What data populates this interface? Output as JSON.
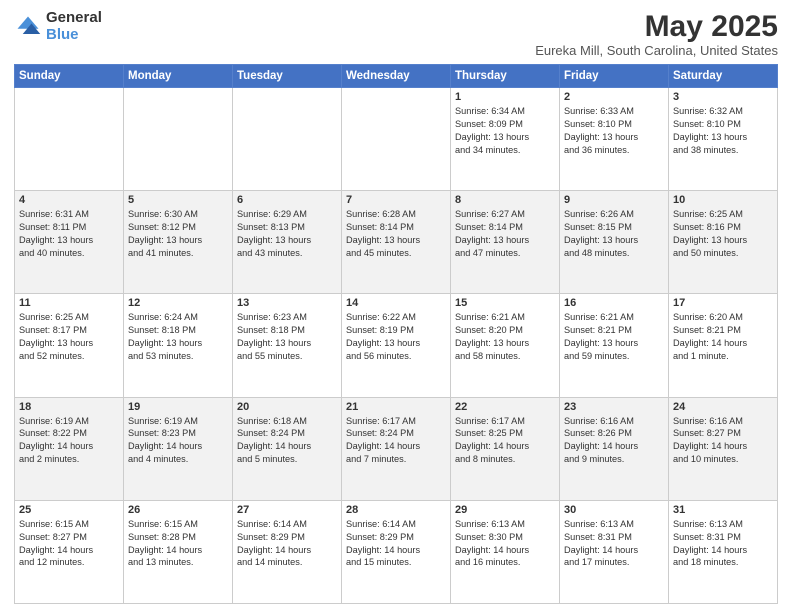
{
  "header": {
    "logo_line1": "General",
    "logo_line2": "Blue",
    "title": "May 2025",
    "subtitle": "Eureka Mill, South Carolina, United States"
  },
  "days_of_week": [
    "Sunday",
    "Monday",
    "Tuesday",
    "Wednesday",
    "Thursday",
    "Friday",
    "Saturday"
  ],
  "weeks": [
    [
      {
        "day": "",
        "info": ""
      },
      {
        "day": "",
        "info": ""
      },
      {
        "day": "",
        "info": ""
      },
      {
        "day": "",
        "info": ""
      },
      {
        "day": "1",
        "info": "Sunrise: 6:34 AM\nSunset: 8:09 PM\nDaylight: 13 hours\nand 34 minutes."
      },
      {
        "day": "2",
        "info": "Sunrise: 6:33 AM\nSunset: 8:10 PM\nDaylight: 13 hours\nand 36 minutes."
      },
      {
        "day": "3",
        "info": "Sunrise: 6:32 AM\nSunset: 8:10 PM\nDaylight: 13 hours\nand 38 minutes."
      }
    ],
    [
      {
        "day": "4",
        "info": "Sunrise: 6:31 AM\nSunset: 8:11 PM\nDaylight: 13 hours\nand 40 minutes."
      },
      {
        "day": "5",
        "info": "Sunrise: 6:30 AM\nSunset: 8:12 PM\nDaylight: 13 hours\nand 41 minutes."
      },
      {
        "day": "6",
        "info": "Sunrise: 6:29 AM\nSunset: 8:13 PM\nDaylight: 13 hours\nand 43 minutes."
      },
      {
        "day": "7",
        "info": "Sunrise: 6:28 AM\nSunset: 8:14 PM\nDaylight: 13 hours\nand 45 minutes."
      },
      {
        "day": "8",
        "info": "Sunrise: 6:27 AM\nSunset: 8:14 PM\nDaylight: 13 hours\nand 47 minutes."
      },
      {
        "day": "9",
        "info": "Sunrise: 6:26 AM\nSunset: 8:15 PM\nDaylight: 13 hours\nand 48 minutes."
      },
      {
        "day": "10",
        "info": "Sunrise: 6:25 AM\nSunset: 8:16 PM\nDaylight: 13 hours\nand 50 minutes."
      }
    ],
    [
      {
        "day": "11",
        "info": "Sunrise: 6:25 AM\nSunset: 8:17 PM\nDaylight: 13 hours\nand 52 minutes."
      },
      {
        "day": "12",
        "info": "Sunrise: 6:24 AM\nSunset: 8:18 PM\nDaylight: 13 hours\nand 53 minutes."
      },
      {
        "day": "13",
        "info": "Sunrise: 6:23 AM\nSunset: 8:18 PM\nDaylight: 13 hours\nand 55 minutes."
      },
      {
        "day": "14",
        "info": "Sunrise: 6:22 AM\nSunset: 8:19 PM\nDaylight: 13 hours\nand 56 minutes."
      },
      {
        "day": "15",
        "info": "Sunrise: 6:21 AM\nSunset: 8:20 PM\nDaylight: 13 hours\nand 58 minutes."
      },
      {
        "day": "16",
        "info": "Sunrise: 6:21 AM\nSunset: 8:21 PM\nDaylight: 13 hours\nand 59 minutes."
      },
      {
        "day": "17",
        "info": "Sunrise: 6:20 AM\nSunset: 8:21 PM\nDaylight: 14 hours\nand 1 minute."
      }
    ],
    [
      {
        "day": "18",
        "info": "Sunrise: 6:19 AM\nSunset: 8:22 PM\nDaylight: 14 hours\nand 2 minutes."
      },
      {
        "day": "19",
        "info": "Sunrise: 6:19 AM\nSunset: 8:23 PM\nDaylight: 14 hours\nand 4 minutes."
      },
      {
        "day": "20",
        "info": "Sunrise: 6:18 AM\nSunset: 8:24 PM\nDaylight: 14 hours\nand 5 minutes."
      },
      {
        "day": "21",
        "info": "Sunrise: 6:17 AM\nSunset: 8:24 PM\nDaylight: 14 hours\nand 7 minutes."
      },
      {
        "day": "22",
        "info": "Sunrise: 6:17 AM\nSunset: 8:25 PM\nDaylight: 14 hours\nand 8 minutes."
      },
      {
        "day": "23",
        "info": "Sunrise: 6:16 AM\nSunset: 8:26 PM\nDaylight: 14 hours\nand 9 minutes."
      },
      {
        "day": "24",
        "info": "Sunrise: 6:16 AM\nSunset: 8:27 PM\nDaylight: 14 hours\nand 10 minutes."
      }
    ],
    [
      {
        "day": "25",
        "info": "Sunrise: 6:15 AM\nSunset: 8:27 PM\nDaylight: 14 hours\nand 12 minutes."
      },
      {
        "day": "26",
        "info": "Sunrise: 6:15 AM\nSunset: 8:28 PM\nDaylight: 14 hours\nand 13 minutes."
      },
      {
        "day": "27",
        "info": "Sunrise: 6:14 AM\nSunset: 8:29 PM\nDaylight: 14 hours\nand 14 minutes."
      },
      {
        "day": "28",
        "info": "Sunrise: 6:14 AM\nSunset: 8:29 PM\nDaylight: 14 hours\nand 15 minutes."
      },
      {
        "day": "29",
        "info": "Sunrise: 6:13 AM\nSunset: 8:30 PM\nDaylight: 14 hours\nand 16 minutes."
      },
      {
        "day": "30",
        "info": "Sunrise: 6:13 AM\nSunset: 8:31 PM\nDaylight: 14 hours\nand 17 minutes."
      },
      {
        "day": "31",
        "info": "Sunrise: 6:13 AM\nSunset: 8:31 PM\nDaylight: 14 hours\nand 18 minutes."
      }
    ]
  ]
}
